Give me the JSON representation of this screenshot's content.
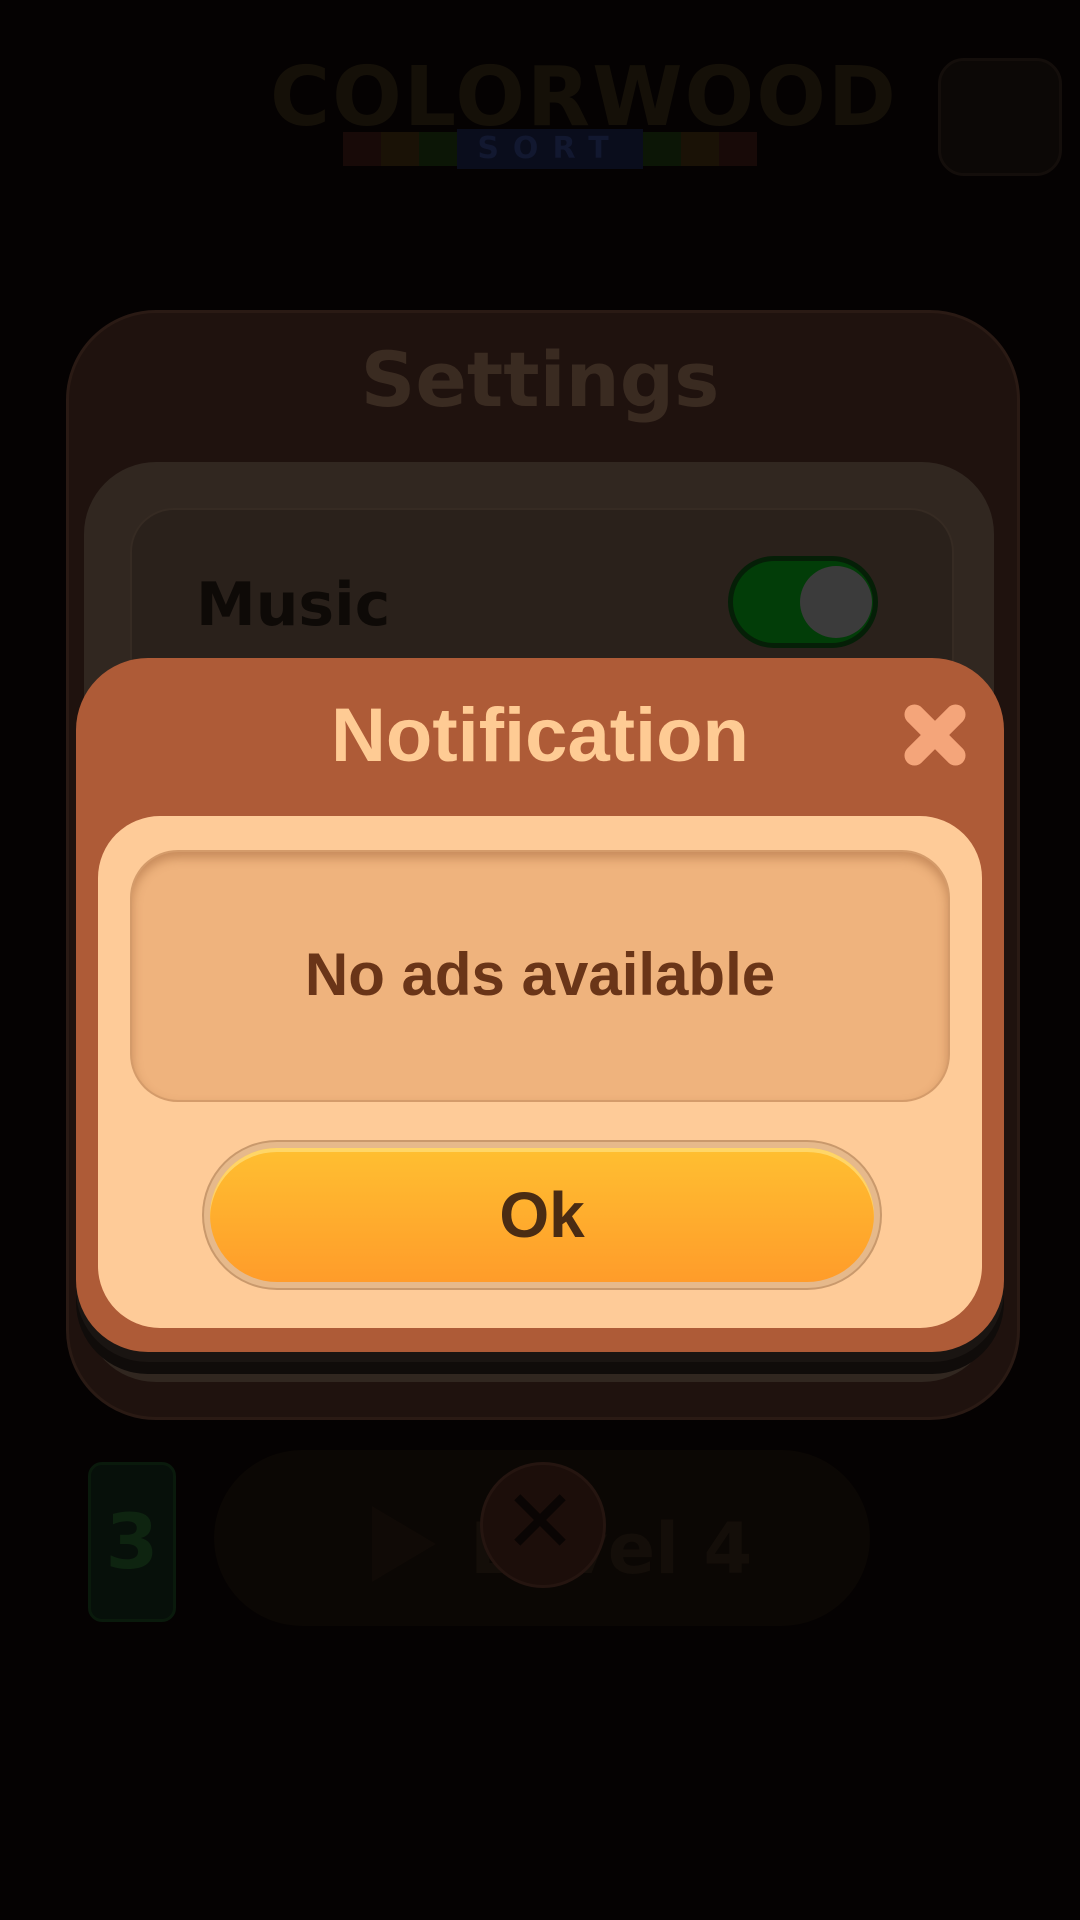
{
  "background": {
    "logo_title": "COLORWOOD",
    "logo_subtitle": "SORT",
    "settings_title": "Settings",
    "music_label": "Music",
    "music_toggle_on": true,
    "level_badge": "3",
    "play_label": "Level 4"
  },
  "notification": {
    "title": "Notification",
    "message": "No ads available",
    "ok_label": "Ok"
  },
  "colors": {
    "dialog_frame": "#ae5b37",
    "dialog_body": "#fecb98",
    "message_box": "#efb37d",
    "title_text": "#fecb94",
    "ok_button_top": "#ffbf31",
    "ok_button_bottom": "#ff9c2a"
  },
  "icons": {
    "close": "close-icon",
    "play": "play-icon"
  }
}
